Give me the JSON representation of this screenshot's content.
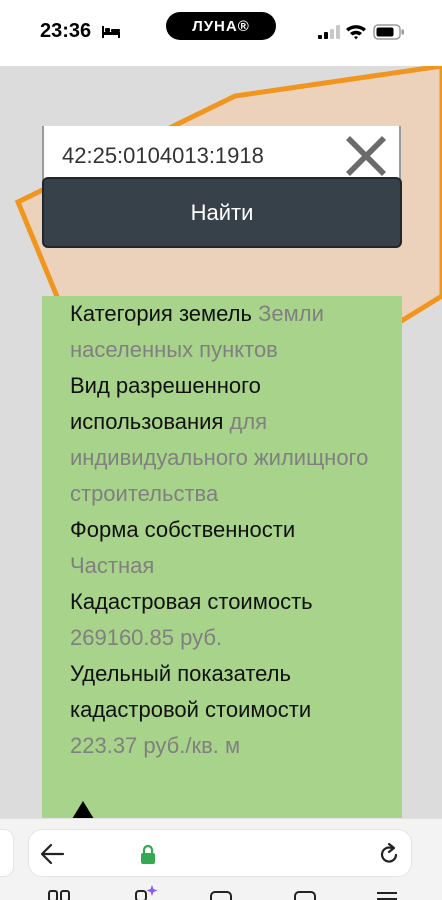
{
  "status_bar": {
    "time": "23:36",
    "carrier": "ЛУНА®"
  },
  "icons": {
    "bed": "bed-icon",
    "signal": "signal-icon",
    "wifi": "wifi-icon",
    "battery": "battery-icon",
    "clear": "close-icon",
    "collapse": "triangle-up-icon",
    "back": "arrow-left-icon",
    "lock": "lock-icon",
    "reload": "reload-icon"
  },
  "search": {
    "value": "42:25:0104013:1918",
    "button_label": "Найти"
  },
  "info": {
    "rows": [
      {
        "label": "Категория земель",
        "value": "Земли населенных пунктов"
      },
      {
        "label": "Вид разрешенного использования",
        "value": "для индивидуального жилищного строительства"
      },
      {
        "label": "Форма собственности",
        "value": "Частная"
      },
      {
        "label": "Кадастровая стоимость",
        "value": "269160.85 руб."
      },
      {
        "label": "Удельный показатель кадастровой стоимости",
        "value": "223.37 руб./кв. м"
      }
    ]
  },
  "colors": {
    "map_background": "#dcdcdc",
    "parcel_fill": "#ecd2bb",
    "parcel_stroke": "#f0961e",
    "button_background": "#37414a",
    "info_panel_background": "#a8d38a",
    "info_value_text": "#808080",
    "lock_accent": "#34a853"
  }
}
